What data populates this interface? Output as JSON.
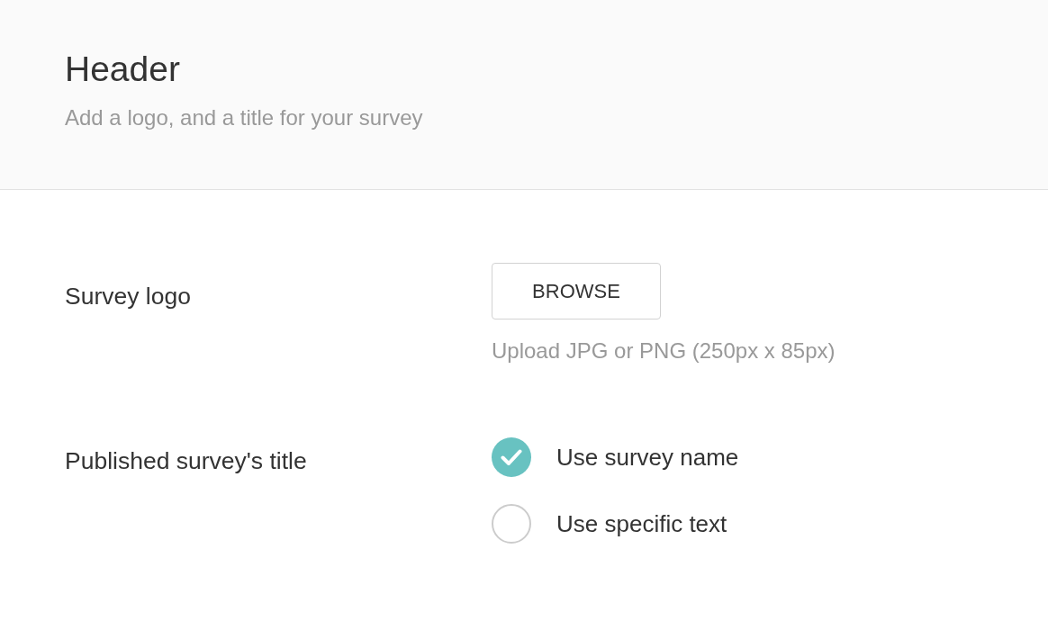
{
  "header": {
    "title": "Header",
    "subtitle": "Add a logo, and a title for your survey"
  },
  "form_rows": [
    {
      "kind": "upload",
      "label": "Survey logo",
      "button": "BROWSE",
      "hint": "Upload JPG or PNG (250px x 85px)"
    },
    {
      "kind": "radio_group",
      "label": "Published survey's title",
      "options": [
        {
          "label": "Use survey name",
          "selected": true
        },
        {
          "label": "Use specific text",
          "selected": false
        }
      ]
    }
  ]
}
